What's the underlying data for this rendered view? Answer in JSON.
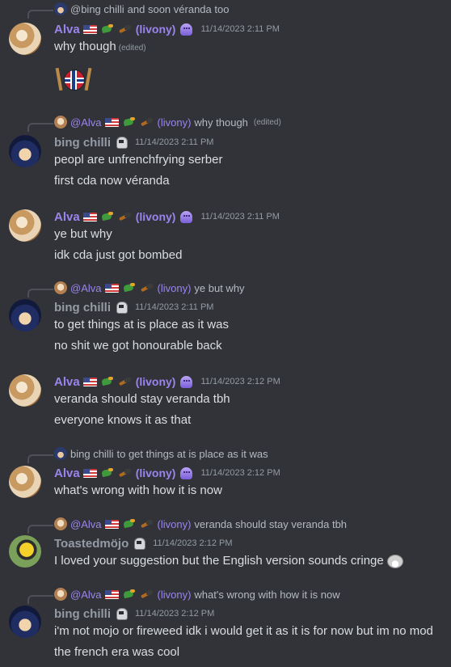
{
  "top_reply": {
    "author": "@bing chilli",
    "text": "and soon véranda too"
  },
  "messages": [
    {
      "author": "Alva",
      "tag": "(livony)",
      "timestamp": "11/14/2023 2:11 PM",
      "lines": [
        "why though"
      ],
      "edited_label": "(edited)",
      "emoji": "norway-ball-with-axes"
    },
    {
      "reply": {
        "author": "@Alva",
        "tag": "(livony)",
        "text": "why though",
        "edited_label": "(edited)"
      },
      "author": "bing chilli",
      "timestamp": "11/14/2023 2:11 PM",
      "lines": [
        "peopl are unfrenchfrying serber",
        "first cda now véranda"
      ]
    },
    {
      "author": "Alva",
      "tag": "(livony)",
      "timestamp": "11/14/2023 2:11 PM",
      "lines": [
        "ye but why",
        "idk cda just got bombed"
      ]
    },
    {
      "reply": {
        "author": "@Alva",
        "tag": "(livony)",
        "text": "ye but why"
      },
      "author": "bing chilli",
      "timestamp": "11/14/2023 2:11 PM",
      "lines": [
        "to get things at is place as it was",
        "no shit we got honourable back"
      ]
    },
    {
      "author": "Alva",
      "tag": "(livony)",
      "timestamp": "11/14/2023 2:12 PM",
      "lines": [
        "veranda should stay veranda tbh",
        "everyone knows it as that"
      ]
    },
    {
      "reply": {
        "author": "bing chilli",
        "text": "to get things at is place as it was"
      },
      "author": "Alva",
      "tag": "(livony)",
      "timestamp": "11/14/2023 2:12 PM",
      "lines": [
        "what's wrong with how it is now"
      ]
    },
    {
      "reply": {
        "author": "@Alva",
        "tag": "(livony)",
        "text": "veranda should stay veranda tbh"
      },
      "author": "Toastedmöjo",
      "timestamp": "11/14/2023 2:12 PM",
      "lines": [
        "I loved your suggestion but the English version sounds cringe"
      ],
      "emoji": "trollface"
    },
    {
      "reply": {
        "author": "@Alva",
        "tag": "(livony)",
        "text": "what's wrong with how it is now"
      },
      "author": "bing chilli",
      "timestamp": "11/14/2023 2:12 PM",
      "lines": [
        "i'm not mojo or fireweed idk i would get it as it is for now but im no mod",
        "the french era was cool"
      ]
    }
  ],
  "colors": {
    "background": "#313338",
    "alva_name": "#9b84ee",
    "gray_name": "#949ba4",
    "text": "#dbdee1"
  },
  "icons": [
    "flag-usa-icon",
    "green-gun-emoji-icon",
    "bird-emoji-icon",
    "purple-ghost-badge-icon",
    "robot-badge-icon",
    "trollface-emoji-icon"
  ]
}
